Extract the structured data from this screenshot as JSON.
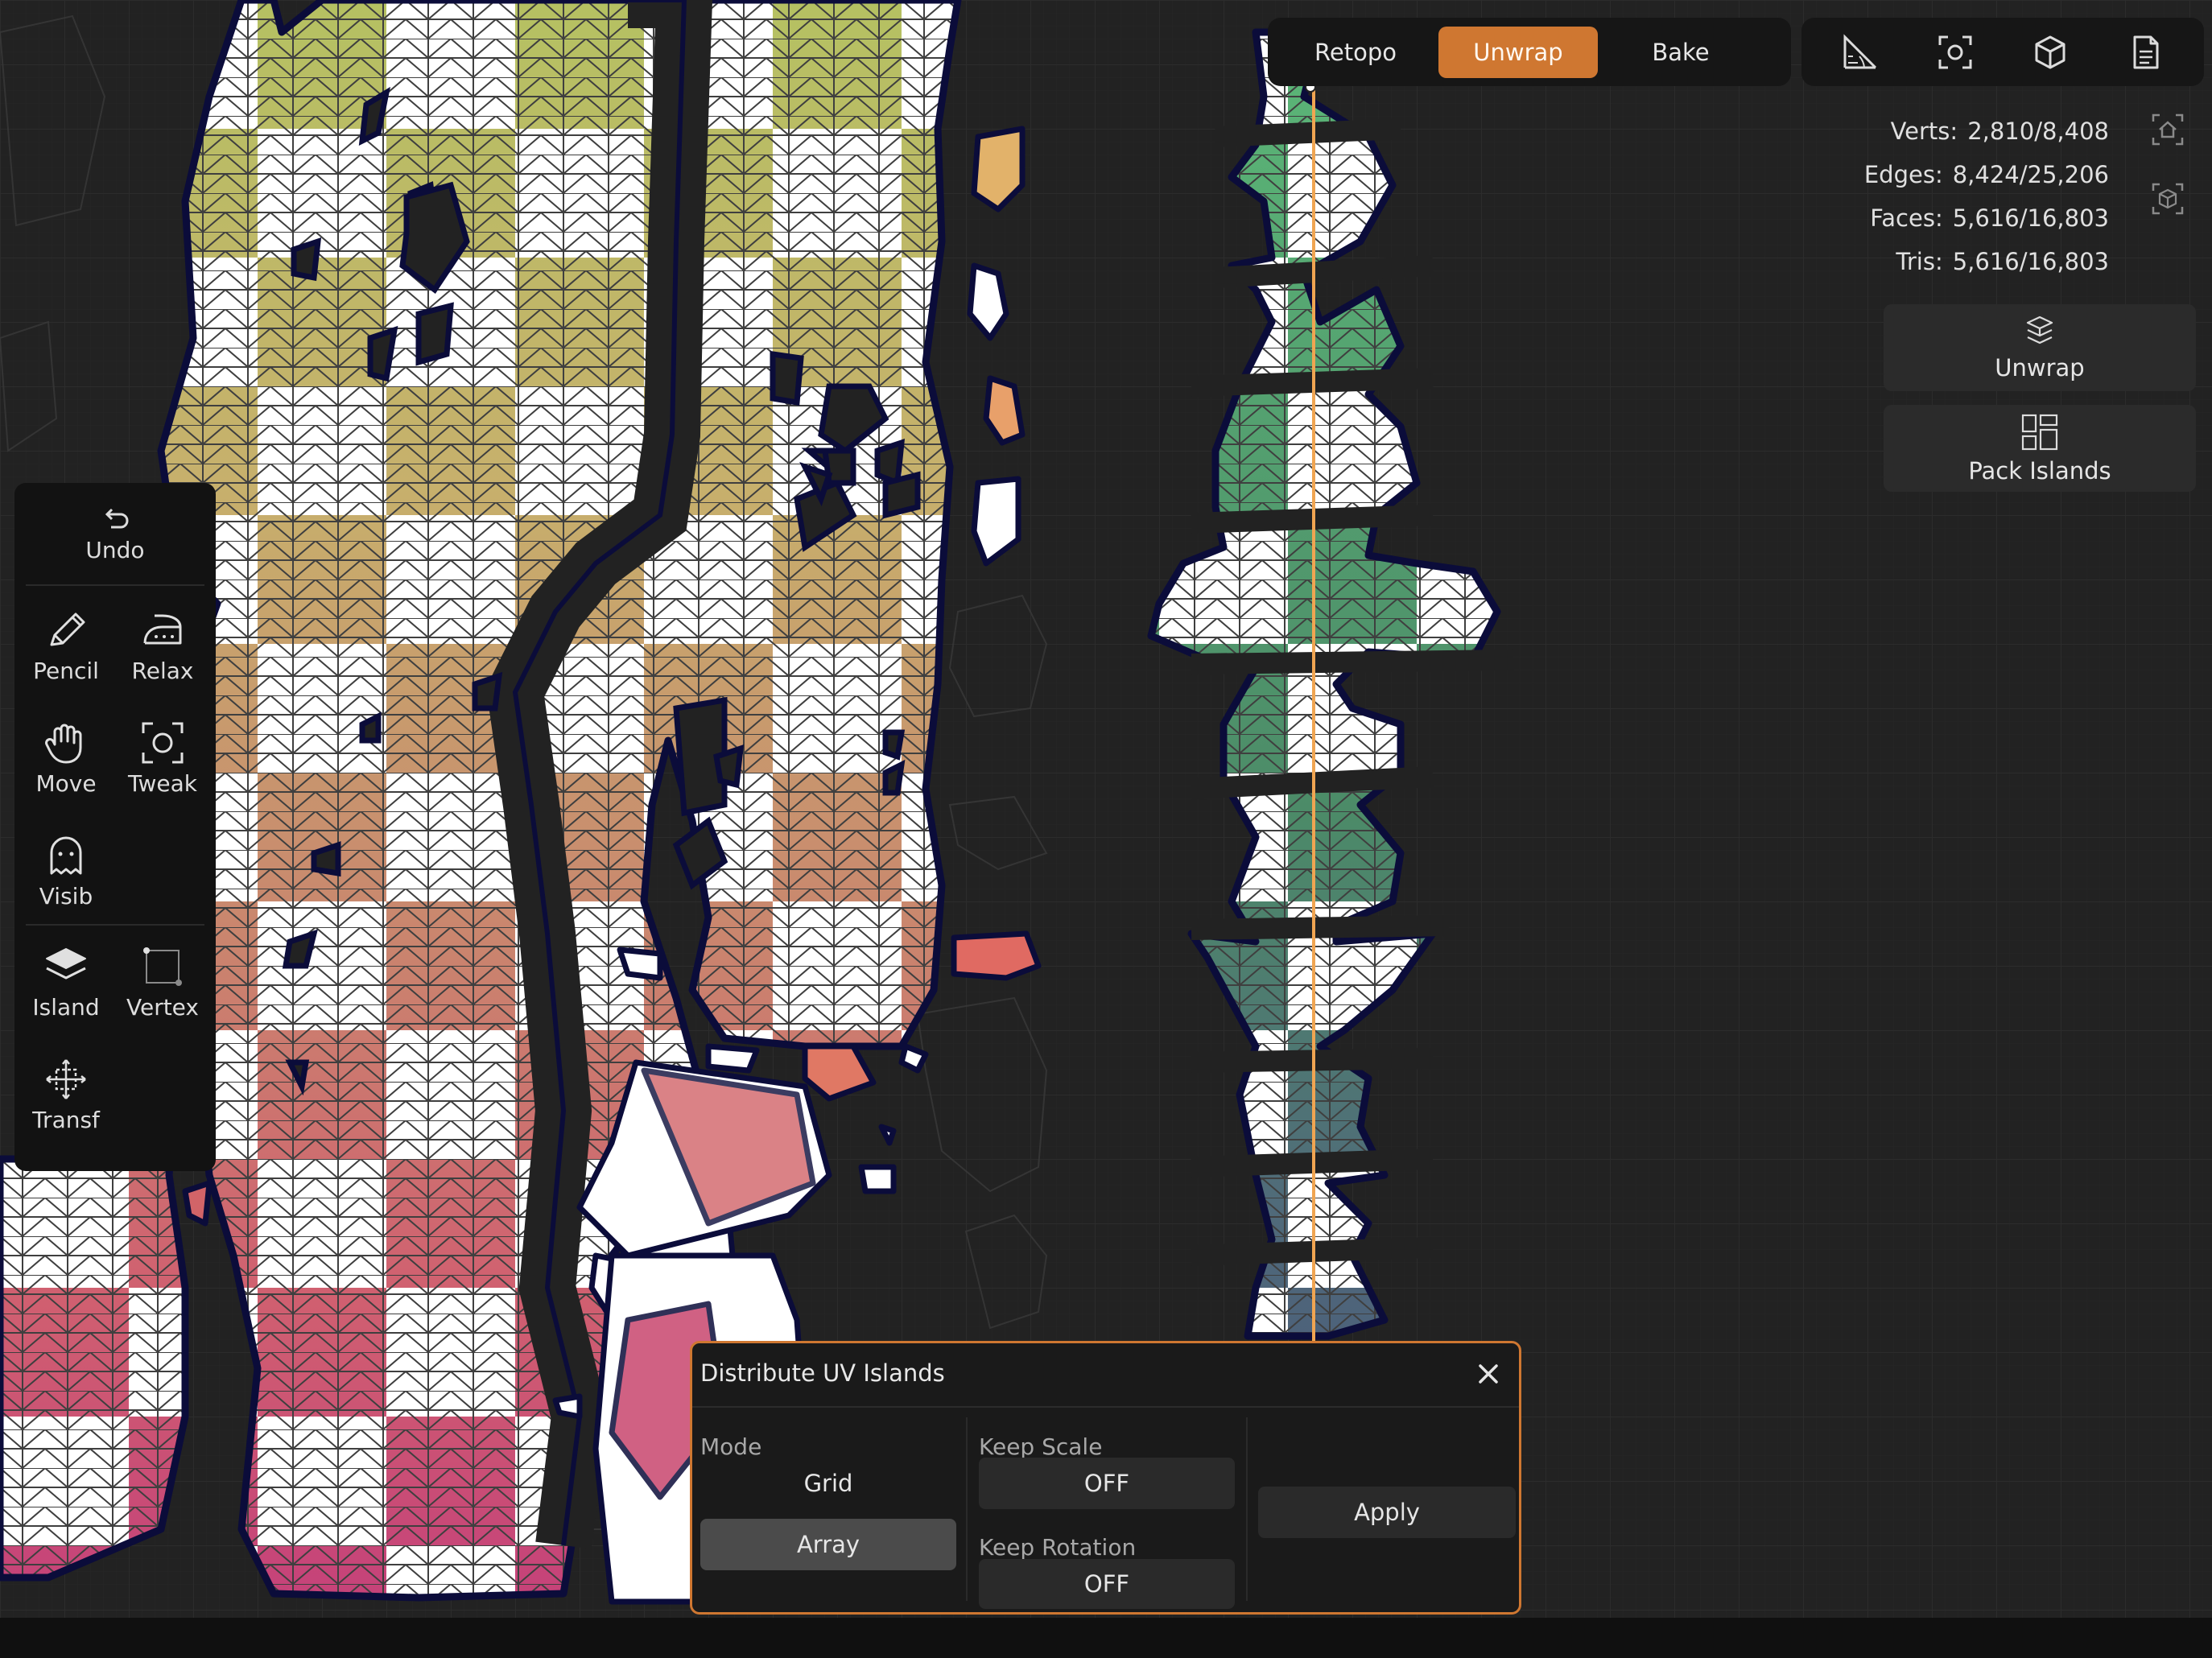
{
  "mode_bar": {
    "tabs": [
      {
        "label": "Retopo",
        "active": false
      },
      {
        "label": "Unwrap",
        "active": true
      },
      {
        "label": "Bake",
        "active": false
      }
    ],
    "active_color": "#cf7731"
  },
  "icon_bar": [
    "measure-icon",
    "focus-frame-icon",
    "cube-icon",
    "document-icon"
  ],
  "stats": {
    "verts": {
      "label": "Verts:",
      "value": "2,810/8,408"
    },
    "edges": {
      "label": "Edges:",
      "value": "8,424/25,206"
    },
    "faces": {
      "label": "Faces:",
      "value": "5,616/16,803"
    },
    "tris": {
      "label": "Tris:",
      "value": "5,616/16,803"
    }
  },
  "side_icons": [
    "home-view-icon",
    "wireframe-cube-icon"
  ],
  "actions": {
    "unwrap": {
      "label": "Unwrap",
      "icon": "unwrap-icon"
    },
    "pack": {
      "label": "Pack Islands",
      "icon": "pack-islands-icon"
    }
  },
  "toolbar": {
    "undo": "Undo",
    "pencil": "Pencil",
    "relax": "Relax",
    "move": "Move",
    "tweak": "Tweak",
    "visib": "Visib",
    "island": "Island",
    "vertex": "Vertex",
    "transf": "Transf"
  },
  "dialog": {
    "title": "Distribute UV Islands",
    "mode_label": "Mode",
    "mode_options": [
      "Grid",
      "Array"
    ],
    "mode_selected": "Array",
    "keep_scale_label": "Keep Scale",
    "keep_scale_value": "OFF",
    "keep_rotation_label": "Keep Rotation",
    "keep_rotation_value": "OFF",
    "apply_label": "Apply"
  },
  "colors": {
    "background": "#222222",
    "accent": "#cf7731",
    "island_outline": "#0b0c3a",
    "checker_white": "#ffffff"
  }
}
